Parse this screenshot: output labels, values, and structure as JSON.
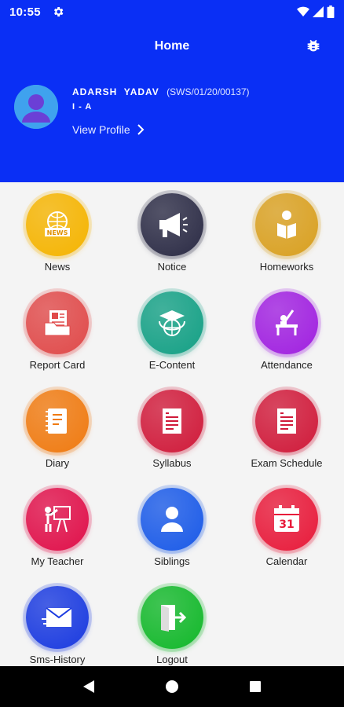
{
  "status_bar": {
    "time": "10:55"
  },
  "header": {
    "title": "Home",
    "student_name": "ADARSH  YADAV",
    "student_code": "(SWS/01/20/00137)",
    "class": "I - A",
    "view_profile": "View Profile"
  },
  "menu": [
    {
      "label": "News",
      "icon": "news-icon",
      "color": "#f5b400"
    },
    {
      "label": "Notice",
      "icon": "megaphone-icon",
      "color": "#2b2b45"
    },
    {
      "label": "Homeworks",
      "icon": "reading-student-icon",
      "color": "#d9a020"
    },
    {
      "label": "Report Card",
      "icon": "report-folder-icon",
      "color": "#e04a4a"
    },
    {
      "label": "E-Content",
      "icon": "graduation-globe-icon",
      "color": "#14a085"
    },
    {
      "label": "Attendance",
      "icon": "raised-hand-desk-icon",
      "color": "#a020e0"
    },
    {
      "label": "Diary",
      "icon": "diary-icon",
      "color": "#f07a10"
    },
    {
      "label": "Syllabus",
      "icon": "document-icon",
      "color": "#d01a3a"
    },
    {
      "label": "Exam Schedule",
      "icon": "document-icon",
      "color": "#d01a3a"
    },
    {
      "label": "My Teacher",
      "icon": "teacher-board-icon",
      "color": "#e0104a"
    },
    {
      "label": "Siblings",
      "icon": "person-icon",
      "color": "#1a5ae8"
    },
    {
      "label": "Calendar",
      "icon": "calendar-icon",
      "color": "#e81a3a"
    },
    {
      "label": "Sms-History",
      "icon": "envelope-icon",
      "color": "#1a3ae0"
    },
    {
      "label": "Logout",
      "icon": "logout-door-icon",
      "color": "#12b82a"
    }
  ],
  "calendar_day": "31"
}
